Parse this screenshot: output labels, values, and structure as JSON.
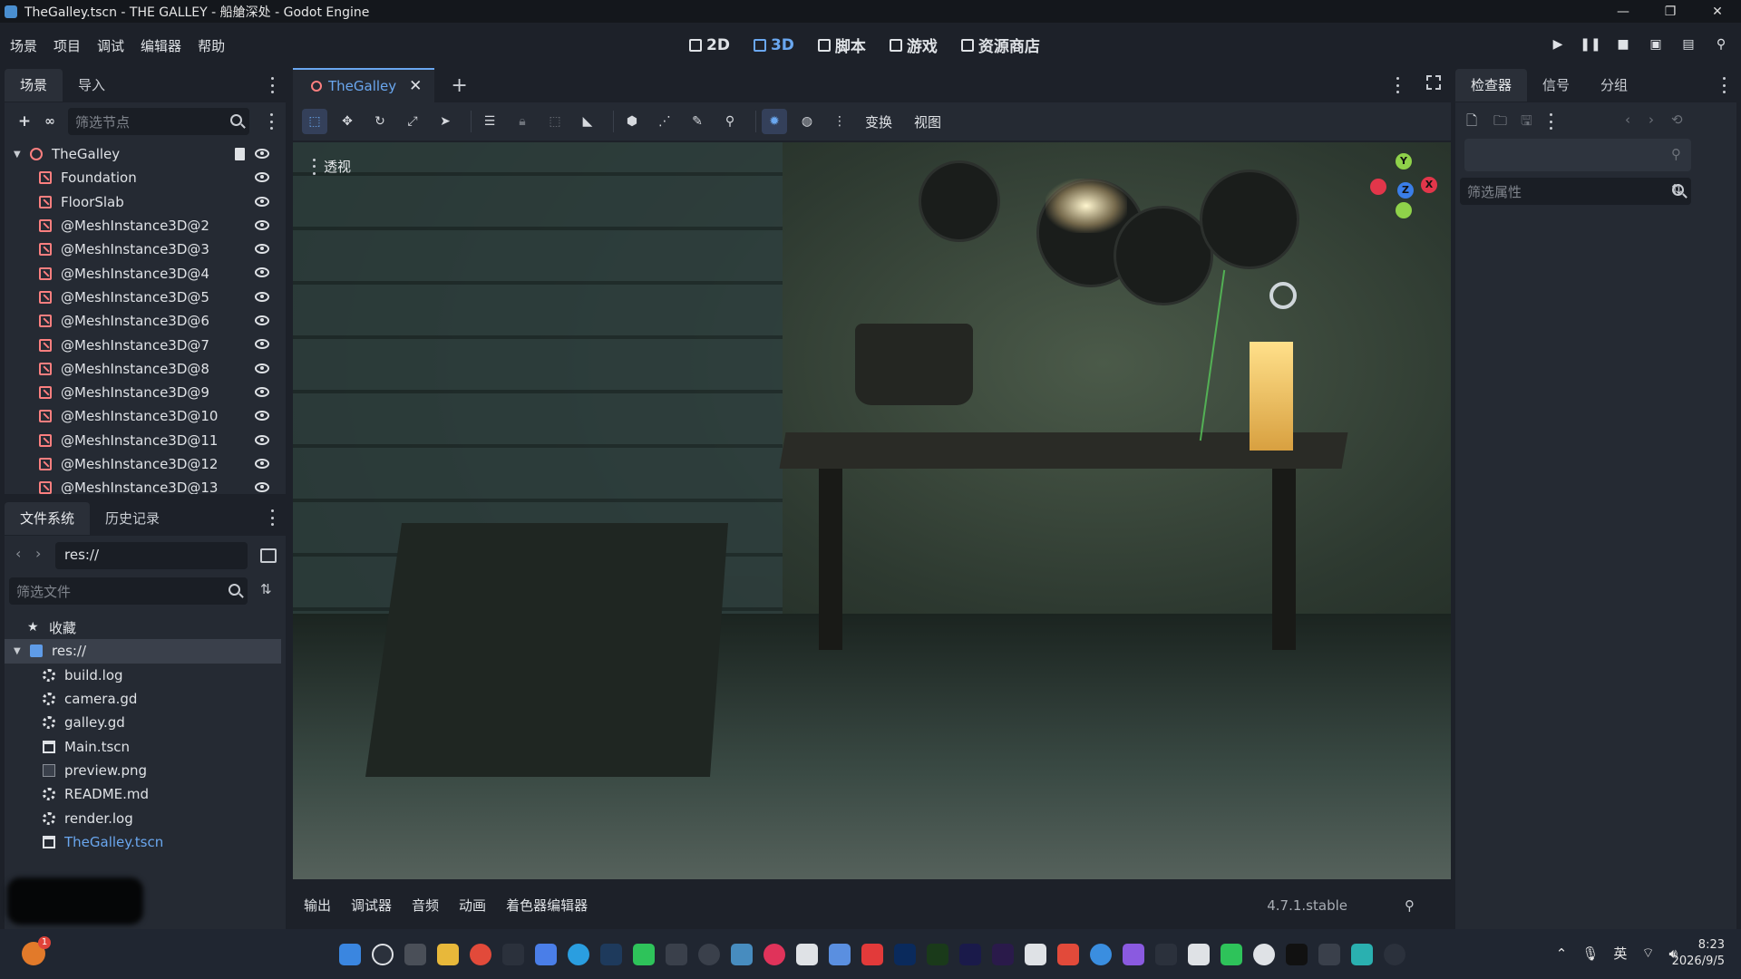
{
  "window": {
    "title": "TheGalley.tscn - THE GALLEY - 船艙深处 - Godot Engine",
    "controls": [
      "—",
      "❐",
      "✕"
    ]
  },
  "menu": {
    "items": [
      "场景",
      "项目",
      "调试",
      "编辑器",
      "帮助"
    ],
    "modes": [
      {
        "label": "2D",
        "active": false
      },
      {
        "label": "3D",
        "active": true
      },
      {
        "label": "脚本",
        "active": false
      },
      {
        "label": "游戏",
        "active": false
      },
      {
        "label": "资源商店",
        "active": false
      }
    ]
  },
  "scene_dock": {
    "tabs": [
      "场景",
      "导入"
    ],
    "filter_placeholder": "筛选节点",
    "root": "TheGalley",
    "nodes": [
      "Foundation",
      "FloorSlab",
      "@MeshInstance3D@2",
      "@MeshInstance3D@3",
      "@MeshInstance3D@4",
      "@MeshInstance3D@5",
      "@MeshInstance3D@6",
      "@MeshInstance3D@7",
      "@MeshInstance3D@8",
      "@MeshInstance3D@9",
      "@MeshInstance3D@10",
      "@MeshInstance3D@11",
      "@MeshInstance3D@12",
      "@MeshInstance3D@13"
    ]
  },
  "filesystem": {
    "tabs": [
      "文件系统",
      "历史记录"
    ],
    "path": "res://",
    "filter_placeholder": "筛选文件",
    "favorites": "收藏",
    "root": "res://",
    "files": [
      {
        "name": "build.log",
        "icon": "gear"
      },
      {
        "name": "camera.gd",
        "icon": "gear"
      },
      {
        "name": "galley.gd",
        "icon": "gear"
      },
      {
        "name": "Main.tscn",
        "icon": "scene"
      },
      {
        "name": "preview.png",
        "icon": "image"
      },
      {
        "name": "README.md",
        "icon": "gear"
      },
      {
        "name": "render.log",
        "icon": "gear"
      },
      {
        "name": "TheGalley.tscn",
        "icon": "scene"
      }
    ]
  },
  "editor": {
    "scene_tab": "TheGalley",
    "toolbar_text": [
      "变换",
      "视图"
    ],
    "viewport_label": "透视",
    "gizmo": {
      "x": "X",
      "y": "Y",
      "z": "Z"
    }
  },
  "bottom_panel": {
    "tabs": [
      "输出",
      "调试器",
      "音频",
      "动画",
      "着色器编辑器"
    ],
    "version": "4.7.1.stable"
  },
  "inspector": {
    "tabs": [
      "检查器",
      "信号",
      "分组"
    ],
    "filter_placeholder": "筛选属性"
  },
  "taskbar": {
    "notification_count": "1",
    "lang": "英",
    "time": "8:23",
    "date": "2026/9/5"
  },
  "colors": {
    "accent": "#6aa7ef",
    "node_icon": "#fc7f7f",
    "panel_bg": "#252a33",
    "base_bg": "#1d2129"
  }
}
